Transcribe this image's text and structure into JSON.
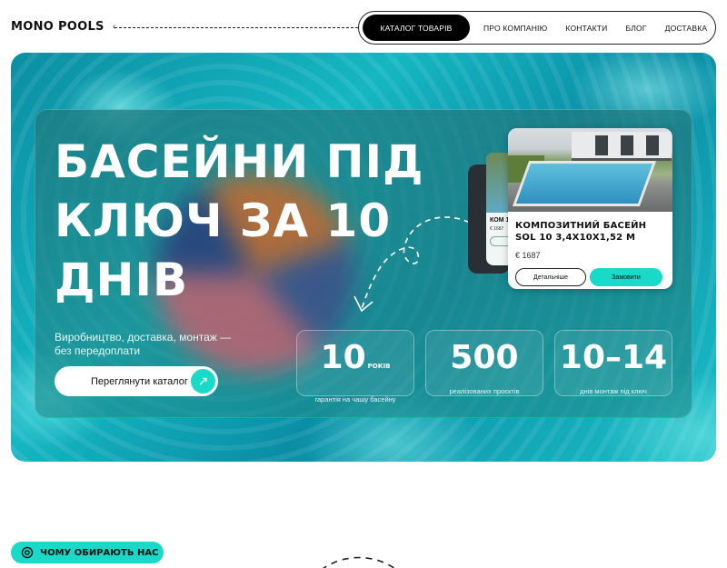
{
  "header": {
    "logo": "MONO POOLS",
    "nav": [
      {
        "label": "КАТАЛОГ ТОВАРІВ",
        "active": true
      },
      {
        "label": "ПРО КОМПАНІЮ"
      },
      {
        "label": "КОНТАКТИ"
      },
      {
        "label": "БЛОГ"
      },
      {
        "label": "ДОСТАВКА"
      }
    ]
  },
  "hero": {
    "title": "БАСЕЙНИ ПІД КЛЮЧ ЗА 10 ДНІВ",
    "subtitle": "Виробництво, доставка, монтаж — без передоплати",
    "cta_label": "Переглянути каталог",
    "stats": [
      {
        "value": "10",
        "unit": "РОКІВ",
        "label": "гарантія на чашу басейну"
      },
      {
        "value": "500",
        "label": "реалізованих проєктів"
      },
      {
        "value": "10–14",
        "label": "днів монтаж під ключ"
      }
    ]
  },
  "product_card": {
    "title": "КОМПОЗИТНИЙ БАСЕЙН SOL 10 3,4Х10Х1,52 М",
    "price": "€ 1687",
    "details_label": "Детальніше",
    "order_label": "Замовити"
  },
  "product_card_back": {
    "title": "КОМ 10 3,",
    "price": "€ 1687"
  },
  "section": {
    "why_label": "ЧОМУ ОБИРАЮТЬ НАС"
  },
  "colors": {
    "accent": "#19d9c8",
    "dark": "#000000"
  }
}
